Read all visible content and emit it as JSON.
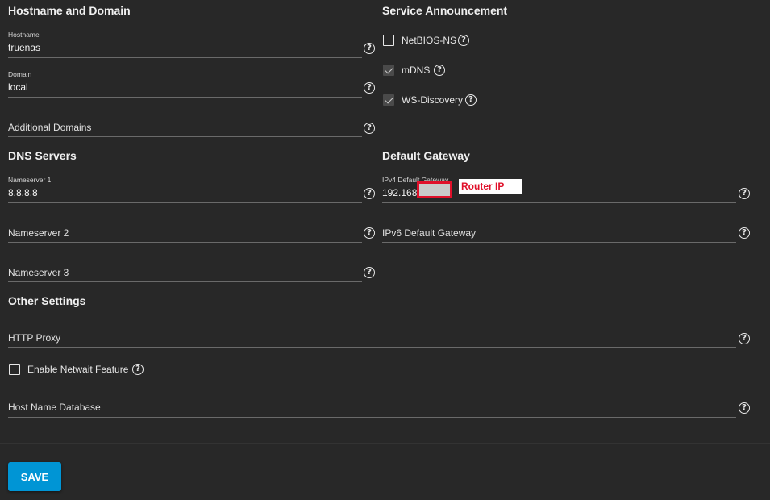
{
  "hostname_domain": {
    "title": "Hostname and Domain",
    "hostname": {
      "label": "Hostname",
      "value": "truenas"
    },
    "domain": {
      "label": "Domain",
      "value": "local"
    },
    "additional_domains": {
      "label": "Additional Domains"
    }
  },
  "service_announcement": {
    "title": "Service Announcement",
    "items": [
      {
        "label": "NetBIOS-NS",
        "checked": false
      },
      {
        "label": "mDNS",
        "checked": true
      },
      {
        "label": "WS-Discovery",
        "checked": true
      }
    ]
  },
  "dns_servers": {
    "title": "DNS Servers",
    "ns1": {
      "label": "Nameserver 1",
      "value": "8.8.8.8"
    },
    "ns2": {
      "label": "Nameserver 2"
    },
    "ns3": {
      "label": "Nameserver 3"
    }
  },
  "default_gateway": {
    "title": "Default Gateway",
    "ipv4": {
      "label": "IPv4 Default Gateway",
      "value": "192.168"
    },
    "ipv6": {
      "label": "IPv6 Default Gateway"
    },
    "annotation": "Router IP"
  },
  "other_settings": {
    "title": "Other Settings",
    "http_proxy": {
      "label": "HTTP Proxy"
    },
    "netwait": {
      "label": "Enable Netwait Feature",
      "checked": false
    },
    "host_name_database": {
      "label": "Host Name Database"
    }
  },
  "actions": {
    "save_label": "SAVE"
  },
  "colors": {
    "background": "#282828",
    "accent": "#0095d5",
    "annotation": "#e0102a"
  },
  "help_glyph": "?"
}
